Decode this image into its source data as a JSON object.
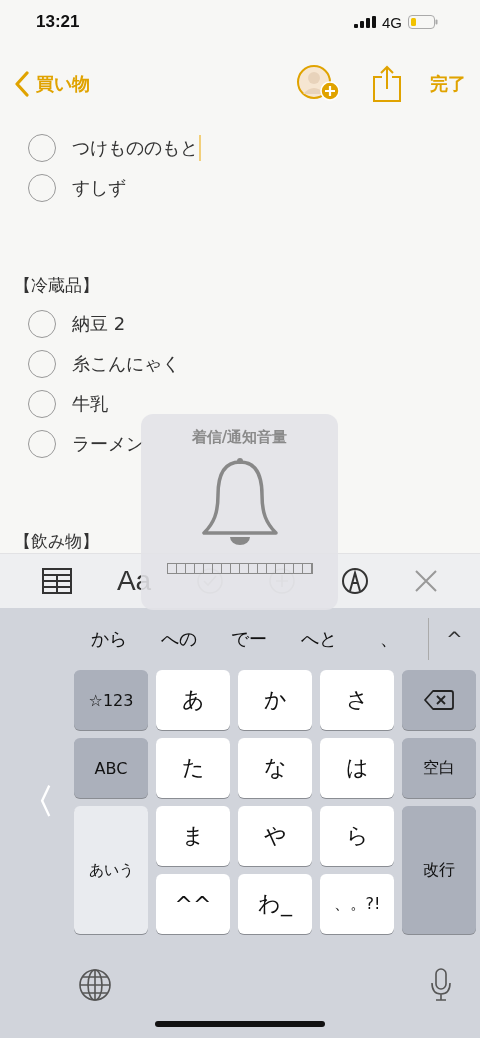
{
  "status_bar": {
    "time": "13:21",
    "network": "4G"
  },
  "nav": {
    "back_label": "買い物",
    "done_label": "完了"
  },
  "note": [
    {
      "kind": "item",
      "text": "つけもののもと",
      "checked": false,
      "cursor": true
    },
    {
      "kind": "item",
      "text": "すしず",
      "checked": false,
      "cursor": false
    },
    {
      "kind": "blank"
    },
    {
      "kind": "heading",
      "text": "【冷蔵品】"
    },
    {
      "kind": "item",
      "text": "納豆 2",
      "checked": false,
      "cursor": false
    },
    {
      "kind": "item",
      "text": "糸こんにゃく",
      "checked": false,
      "cursor": false
    },
    {
      "kind": "item",
      "text": "牛乳",
      "checked": false,
      "cursor": false
    },
    {
      "kind": "item",
      "text": "ラーメン",
      "checked": false,
      "cursor": false
    },
    {
      "kind": "blank"
    },
    {
      "kind": "heading",
      "text": "【飲み物】"
    }
  ],
  "toolbar": {
    "format_label": "Aa"
  },
  "volume_hud": {
    "title": "着信/通知音量",
    "level": 0
  },
  "keyboard": {
    "candidates": [
      "から",
      "への",
      "でー",
      "へと",
      "、"
    ],
    "expand_label": "^",
    "keys": [
      {
        "kind": "function",
        "label": "☆123"
      },
      {
        "kind": "letter",
        "label": "あ"
      },
      {
        "kind": "letter",
        "label": "か"
      },
      {
        "kind": "letter",
        "label": "さ"
      },
      {
        "kind": "delete"
      },
      {
        "kind": "function",
        "label": "ABC"
      },
      {
        "kind": "letter",
        "label": "た"
      },
      {
        "kind": "letter",
        "label": "な"
      },
      {
        "kind": "letter",
        "label": "は"
      },
      {
        "kind": "function",
        "label": "空白"
      },
      {
        "kind": "mode",
        "label": "あいう"
      },
      {
        "kind": "letter",
        "label": "ま"
      },
      {
        "kind": "letter",
        "label": "や"
      },
      {
        "kind": "letter",
        "label": "ら"
      },
      {
        "kind": "tall",
        "label": "改行"
      },
      {
        "kind": "letter",
        "label": "^^"
      },
      {
        "kind": "letter",
        "label": "わ_"
      },
      {
        "kind": "small",
        "label": "、。?!"
      }
    ],
    "side_label": "〈"
  }
}
